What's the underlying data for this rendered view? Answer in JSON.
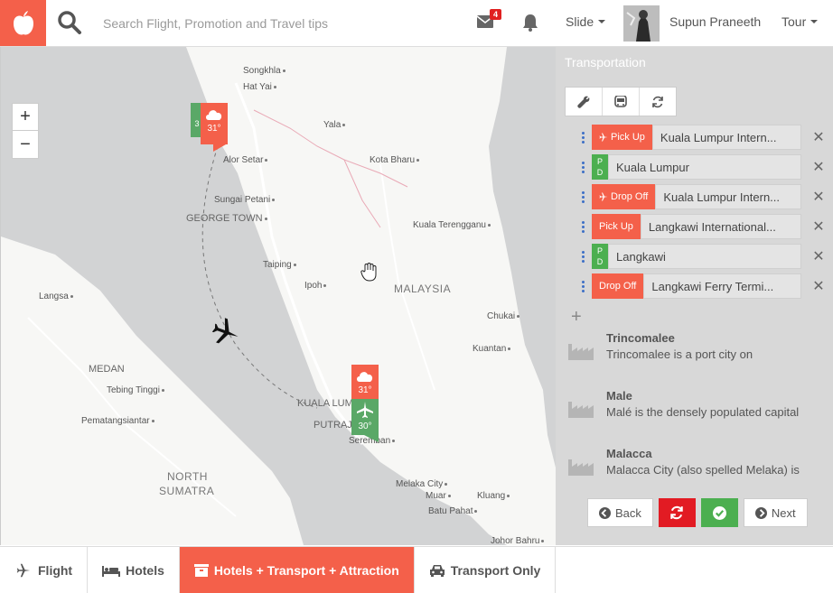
{
  "header": {
    "search_placeholder": "Search Flight, Promotion and Travel tips",
    "mail_count": "4",
    "slide_label": "Slide",
    "username": "Supun Praneeth",
    "tour_label": "Tour"
  },
  "map": {
    "zoom_in": "+",
    "zoom_out": "−",
    "labels": {
      "songkhla": "Songkhla",
      "hat_yai": "Hat Yai",
      "yala": "Yala",
      "alor_setar": "Alor Setar",
      "kota_bharu": "Kota Bharu",
      "sungai_petani": "Sungai Petani",
      "george_town": "GEORGE TOWN",
      "kuala_terengganu": "Kuala Terengganu",
      "langsa": "Langsa",
      "taiping": "Taiping",
      "ipoh": "Ipoh",
      "malaysia": "MALAYSIA",
      "chukai": "Chukai",
      "kuantan": "Kuantan",
      "medan": "MEDAN",
      "tebing_tinggi": "Tebing Tinggi",
      "pematangsiantar": "Pematangsiantar",
      "kuala_lumpur": "KUALA LUM",
      "putrajaya": "PUTRAJ",
      "seremban": "Seremban",
      "north_sumatra_1": "NORTH",
      "north_sumatra_2": "SUMATRA",
      "melaka_city": "Melaka City",
      "muar": "Muar",
      "kluang": "Kluang",
      "batu_pahat": "Batu Pahat",
      "johor_bahru": "Johor Bahru"
    },
    "markers": {
      "north_weather_temp": "31°",
      "north_flight_temp": "3",
      "south_weather_temp": "31°",
      "south_flight_temp": "30°"
    }
  },
  "panel": {
    "title": "Transportation",
    "rows": [
      {
        "tag": "Pick Up",
        "value": "Kuala Lumpur Intern...",
        "type": "pickup-flight"
      },
      {
        "tag": "P D",
        "value": "Kuala Lumpur",
        "type": "pd"
      },
      {
        "tag": "Drop Off",
        "value": "Kuala Lumpur Intern...",
        "type": "dropoff-flight"
      },
      {
        "tag": "Pick Up",
        "value": "Langkawi International...",
        "type": "pickup"
      },
      {
        "tag": "P D",
        "value": "Langkawi",
        "type": "pd"
      },
      {
        "tag": "Drop Off",
        "value": "Langkawi Ferry Termi...",
        "type": "dropoff"
      }
    ],
    "places": [
      {
        "name": "Trincomalee",
        "desc": "Trincomalee is a port city on"
      },
      {
        "name": "Male",
        "desc": "Malé is the densely populated capital"
      },
      {
        "name": "Malacca",
        "desc": "Malacca City (also spelled Melaka) is"
      }
    ],
    "back_label": "Back",
    "next_label": "Next"
  },
  "tabs": [
    {
      "label": "Flight",
      "icon": "plane-icon"
    },
    {
      "label": "Hotels",
      "icon": "bed-icon"
    },
    {
      "label": "Hotels + Transport + Attraction",
      "icon": "suitcase-icon",
      "active": true
    },
    {
      "label": "Transport Only",
      "icon": "car-icon"
    }
  ],
  "colors": {
    "accent": "#f4604a",
    "green": "#4caf50",
    "red": "#e21b23",
    "link_blue": "#3c6fc6"
  }
}
